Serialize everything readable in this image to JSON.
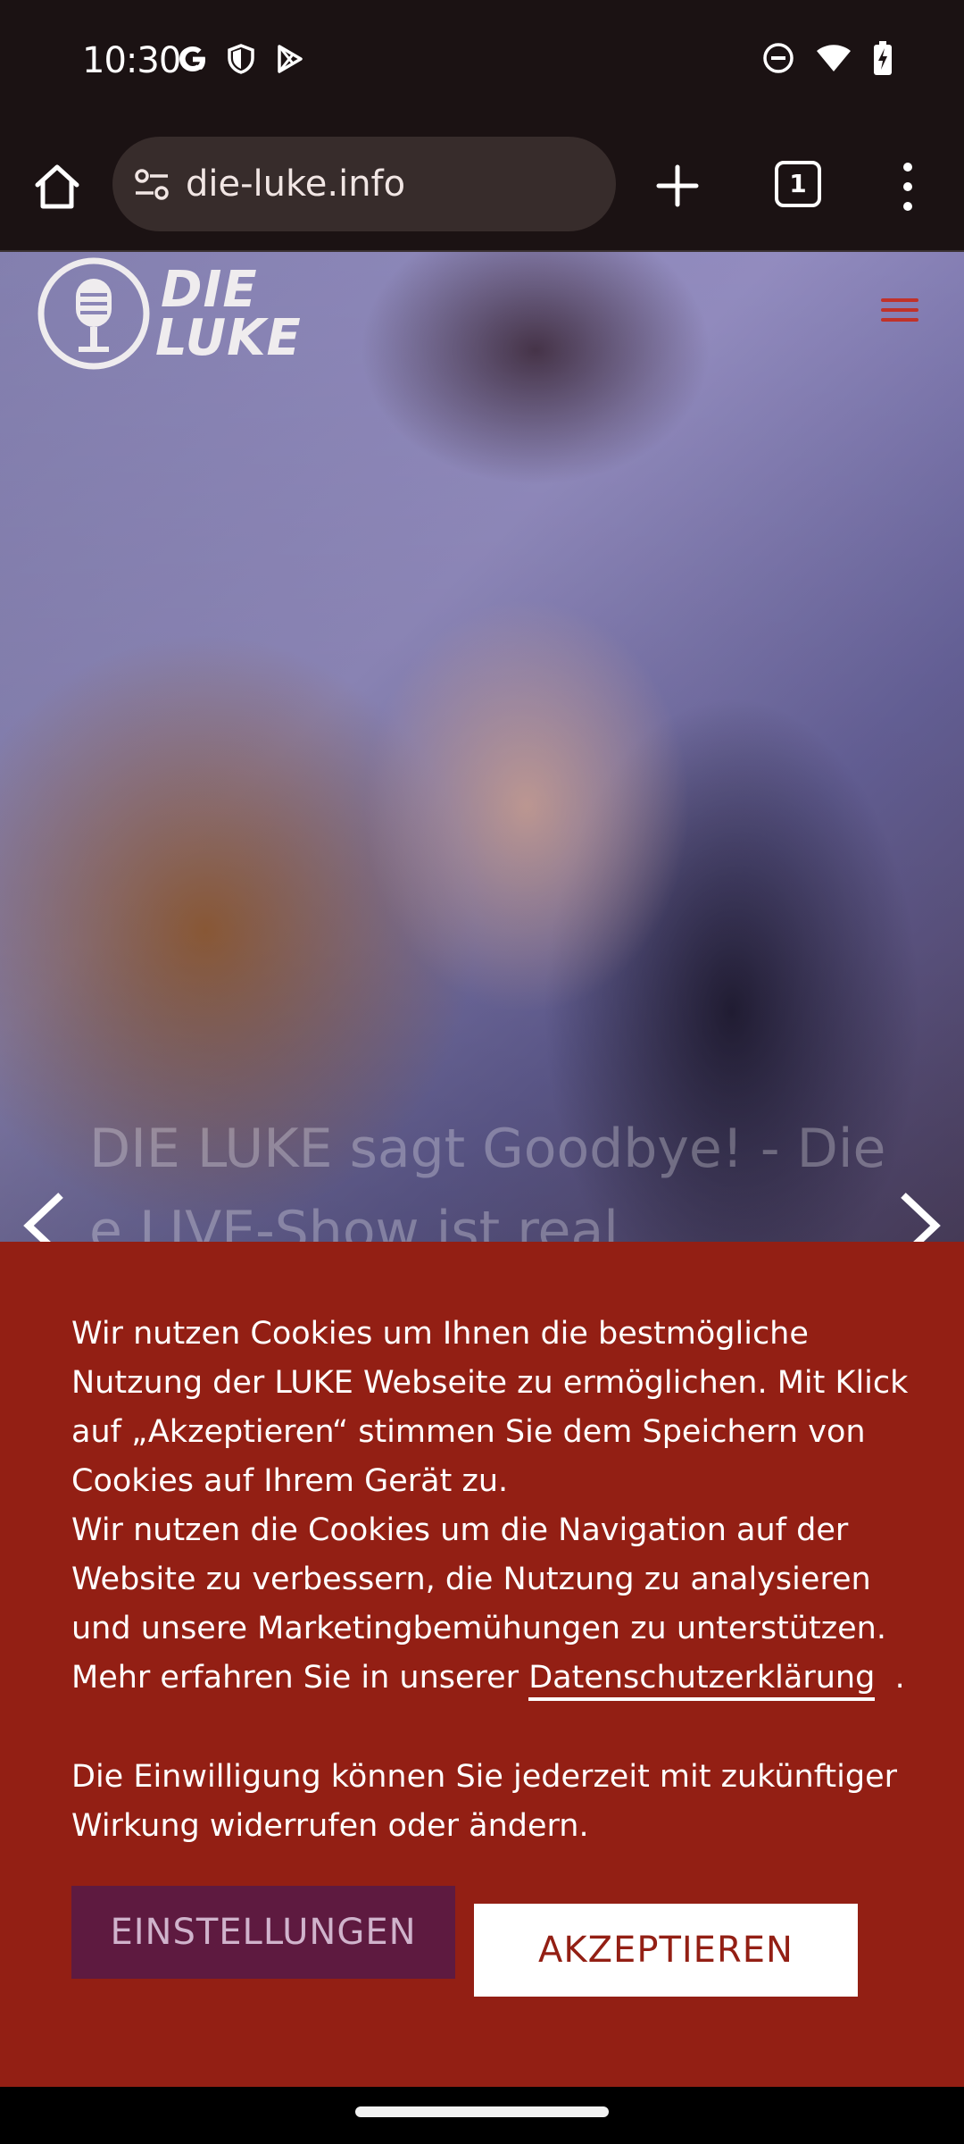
{
  "status_bar": {
    "time": "10:30",
    "left_icons": [
      "google-icon",
      "shield-icon",
      "play-store-icon"
    ],
    "right_icons": [
      "do-not-disturb-icon",
      "wifi-icon",
      "battery-charging-icon"
    ]
  },
  "browser": {
    "url": "die-luke.info",
    "tab_count": "1",
    "icons": [
      "home-icon",
      "site-settings-icon",
      "new-tab-icon",
      "tab-switcher-icon",
      "more-menu-icon"
    ]
  },
  "site": {
    "logo_line1": "DIE",
    "logo_line2": "LUKE",
    "slide_caption_line1": "DIE LUKE sagt Goodbye! - Die",
    "slide_caption_line2": "e LIVE-Show ist real"
  },
  "cookie_banner": {
    "text_1": "Wir nutzen Cookies um Ihnen die bestmögliche Nutzung der LUKE Webseite zu ermöglichen. Mit Klick auf „Akzeptieren“ stimmen Sie dem Speichern von Cookies auf Ihrem Gerät zu.",
    "text_2": "Wir nutzen die Cookies um die Navigation auf der Website zu verbessern, die Nutzung zu analysieren und unsere Marketingbemühungen zu unterstützen.",
    "text_3_prefix": "Mehr erfahren Sie in unserer ",
    "privacy_link": "Datenschutzerklärung",
    "text_3_suffix": "  .",
    "text_4": "Die Einwilligung können Sie jederzeit mit zukünftiger Wirkung widerrufen oder ändern.",
    "settings_button": "EINSTELLUNGEN",
    "accept_button": "AKZEPTIEREN"
  },
  "colors": {
    "banner_bg": "#931f14",
    "settings_bg": "#5e1a40",
    "accept_bg": "#ffffff",
    "menu_red": "#c0322a"
  }
}
